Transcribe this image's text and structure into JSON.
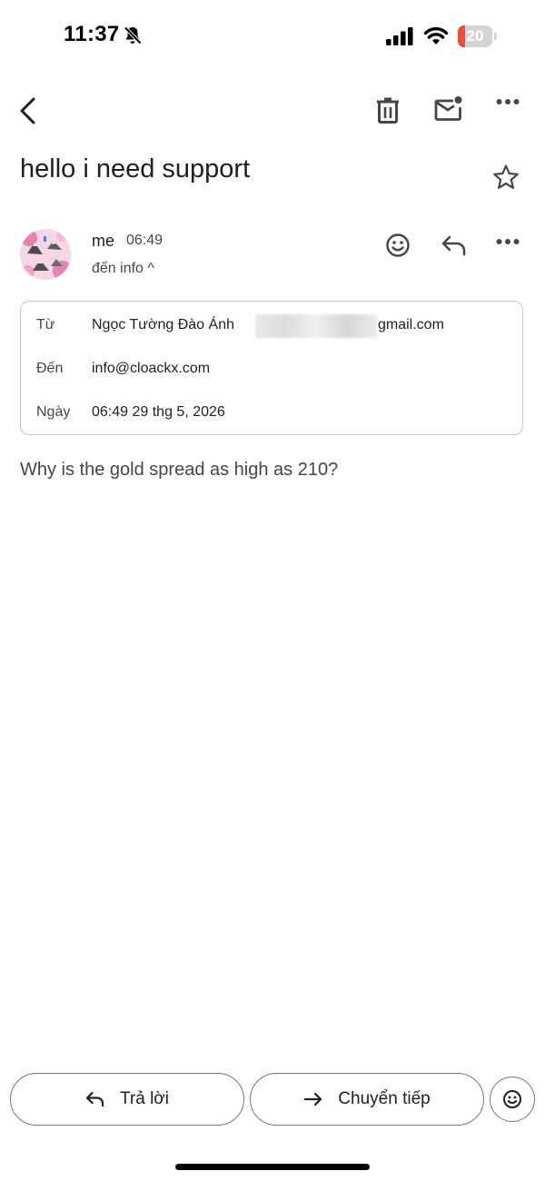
{
  "status_bar": {
    "time": "11:37",
    "battery_level": "20",
    "battery_fraction": 0.2,
    "battery_color": "#eb4d3d",
    "icons": [
      "bell-slash-icon",
      "signal-icon",
      "wifi-icon",
      "battery-icon"
    ]
  },
  "toolbar": {
    "icons": [
      "back-arrow-icon",
      "trash-icon",
      "mark-unread-icon",
      "more-icon"
    ]
  },
  "email": {
    "subject": "hello i need support",
    "sender": "me",
    "time": "06:49",
    "to_summary": "đến info ^",
    "body": "Why is the gold spread as high as 210?"
  },
  "details": {
    "from_label": "Từ",
    "from_name": "Ngọc Tường Đào Ánh",
    "from_email_domain": "gmail.com",
    "to_label": "Đến",
    "to_value": "info@cloackx.com",
    "date_label": "Ngày",
    "date_value": "06:49 29 thg 5, 2026"
  },
  "actions": {
    "reply_label": "Trả lời",
    "forward_label": "Chuyển tiếp"
  }
}
